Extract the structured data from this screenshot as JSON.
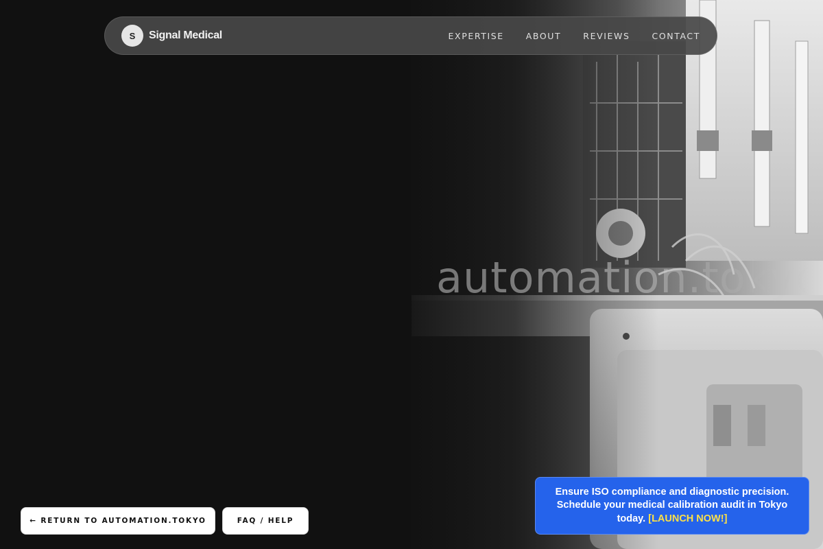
{
  "brand": {
    "logo_letter": "S",
    "name": "Signal Medical"
  },
  "nav": {
    "items": [
      {
        "label": "EXPERTISE"
      },
      {
        "label": "ABOUT"
      },
      {
        "label": "REVIEWS"
      },
      {
        "label": "CONTACT"
      }
    ]
  },
  "hero": {
    "watermark_text": "automation.tokyo"
  },
  "footer_buttons": {
    "return_label": "← RETURN TO AUTOMATION.TOKYO",
    "faq_label": "FAQ / HELP"
  },
  "cta": {
    "text": "Ensure ISO compliance and diagnostic precision. Schedule your medical calibration audit in Tokyo today.",
    "link_label": "[LAUNCH NOW!]",
    "background_color": "#2563eb",
    "link_color": "#fde047"
  }
}
